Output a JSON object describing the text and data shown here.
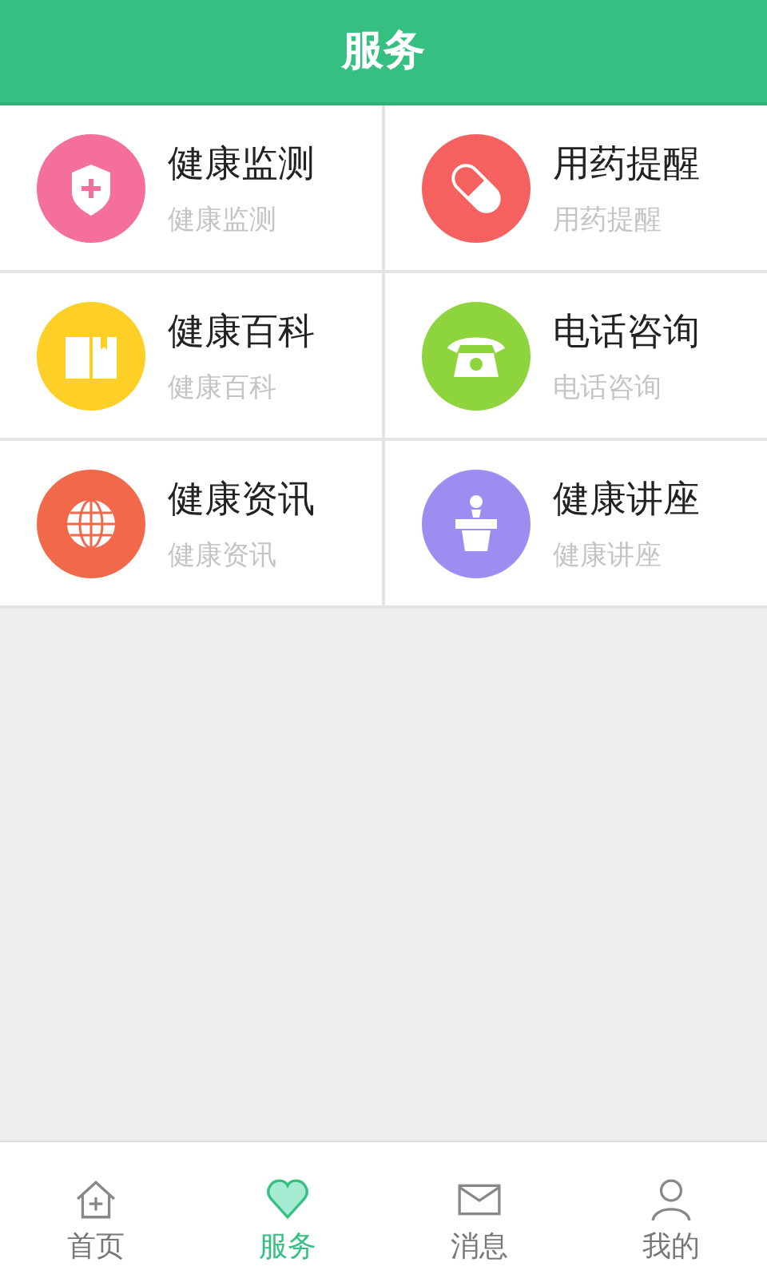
{
  "header": {
    "title": "服务"
  },
  "services": [
    {
      "kind": "shield",
      "color": "#f56f9b",
      "title": "健康监测",
      "subtitle": "健康监测"
    },
    {
      "kind": "pill",
      "color": "#f4615e",
      "title": "用药提醒",
      "subtitle": "用药提醒"
    },
    {
      "kind": "book",
      "color": "#fdcf27",
      "title": "健康百科",
      "subtitle": "健康百科"
    },
    {
      "kind": "phone",
      "color": "#8dd43d",
      "title": "电话咨询",
      "subtitle": "电话咨询"
    },
    {
      "kind": "globe",
      "color": "#f2684a",
      "title": "健康资讯",
      "subtitle": "健康资讯"
    },
    {
      "kind": "lectern",
      "color": "#9d8df0",
      "title": "健康讲座",
      "subtitle": "健康讲座"
    }
  ],
  "tabs": [
    {
      "kind": "home",
      "label": "首页",
      "selected": false
    },
    {
      "kind": "heart",
      "label": "服务",
      "selected": true
    },
    {
      "kind": "mail",
      "label": "消息",
      "selected": false
    },
    {
      "kind": "person",
      "label": "我的",
      "selected": false
    }
  ]
}
